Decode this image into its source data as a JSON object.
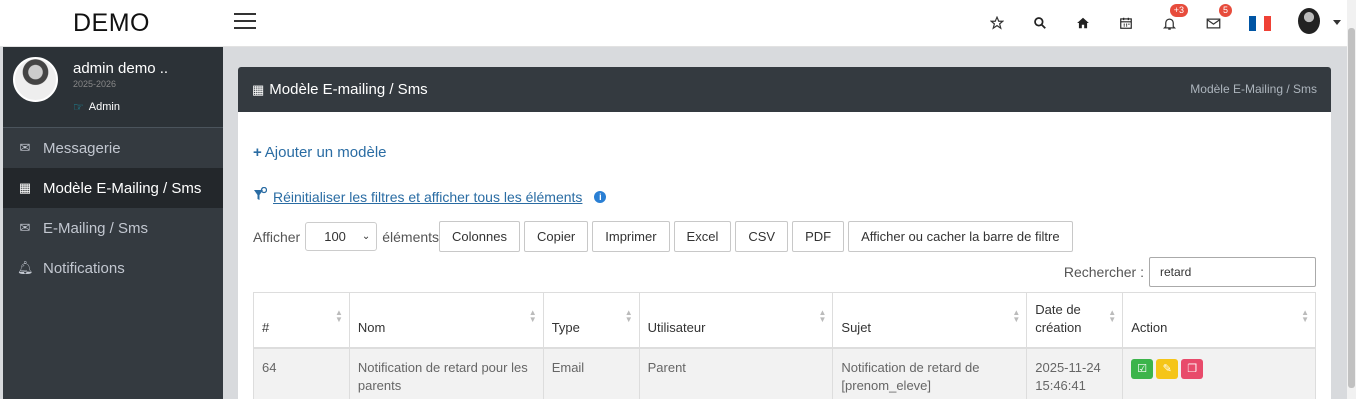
{
  "brand": "DEMO",
  "topbar": {
    "notif_badge": "+3",
    "mail_badge": "5",
    "flag_colors": [
      "#0055A4",
      "#FFFFFF",
      "#EF4135"
    ]
  },
  "user": {
    "name": "admin demo ..",
    "year": "2025-2026",
    "role": "Admin"
  },
  "sidebar": {
    "items": [
      {
        "label": "Messagerie",
        "icon": "envelope-icon"
      },
      {
        "label": "Modèle E-Mailing / Sms",
        "icon": "table-icon"
      },
      {
        "label": "E-Mailing / Sms",
        "icon": "envelope-open-icon"
      },
      {
        "label": "Notifications",
        "icon": "bell-icon"
      }
    ],
    "active_index": 1
  },
  "page": {
    "title": "Modèle E-mailing / Sms",
    "breadcrumb": "Modèle E-Mailing / Sms",
    "add_label": "Ajouter un modèle",
    "reset_label": "Réinitialiser les filtres et afficher tous les éléments"
  },
  "controls": {
    "show_label": "Afficher",
    "page_size": "100",
    "elements_label": "éléments",
    "buttons": [
      "Colonnes",
      "Copier",
      "Imprimer",
      "Excel",
      "CSV",
      "PDF",
      "Afficher ou cacher la barre de filtre"
    ],
    "search_label": "Rechercher :",
    "search_value": "retard"
  },
  "table": {
    "headers": [
      "#",
      "Nom",
      "Type",
      "Utilisateur",
      "Sujet",
      "Date de création",
      "Action"
    ],
    "rows": [
      {
        "id": "64",
        "nom": "Notification de retard pour les parents",
        "type": "Email",
        "utilisateur": "Parent",
        "sujet": "Notification de retard de [prenom_eleve]",
        "date": "2025-11-24 15:46:41"
      }
    ]
  }
}
